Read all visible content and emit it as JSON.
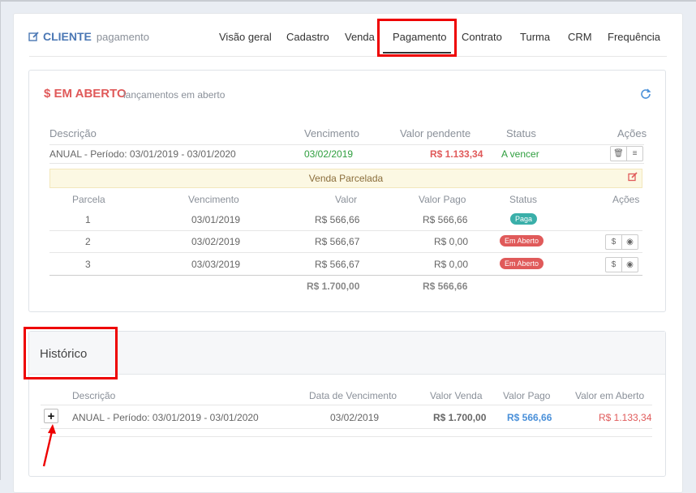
{
  "header": {
    "title": "CLIENTE",
    "subtitle": "pagamento",
    "tabs": [
      "Visão geral",
      "Cadastro",
      "Venda",
      "Pagamento",
      "Contrato",
      "Turma",
      "CRM",
      "Frequência"
    ],
    "active_tab": "Pagamento"
  },
  "em_aberto": {
    "title": "$ EM ABERTO",
    "subtitle": "lançamentos em aberto",
    "columns": [
      "Descrição",
      "Vencimento",
      "Valor pendente",
      "Status",
      "Ações"
    ],
    "row": {
      "descricao": "ANUAL - Período: 03/01/2019 - 03/01/2020",
      "vencimento": "03/02/2019",
      "valor": "R$ 1.133,34",
      "status": "A vencer"
    },
    "venda_label": "Venda Parcelada",
    "parcelas_columns": [
      "Parcela",
      "Vencimento",
      "Valor",
      "Valor Pago",
      "Status",
      "Ações"
    ],
    "parcelas": [
      {
        "n": "1",
        "vencimento": "03/01/2019",
        "valor": "R$ 566,66",
        "pago": "R$ 566,66",
        "status": "Paga"
      },
      {
        "n": "2",
        "vencimento": "03/02/2019",
        "valor": "R$ 566,67",
        "pago": "R$ 0,00",
        "status": "Em Aberto"
      },
      {
        "n": "3",
        "vencimento": "03/03/2019",
        "valor": "R$ 566,67",
        "pago": "R$ 0,00",
        "status": "Em Aberto"
      }
    ],
    "total_valor": "R$ 1.700,00",
    "total_pago": "R$ 566,66"
  },
  "historico": {
    "title": "Histórico",
    "columns": [
      "Descrição",
      "Data de Vencimento",
      "Valor Venda",
      "Valor Pago",
      "Valor em Aberto"
    ],
    "row": {
      "descricao": "ANUAL - Período: 03/01/2019 - 03/01/2020",
      "vencimento": "03/02/2019",
      "valor_venda": "R$ 1.700,00",
      "valor_pago": "R$ 566,66",
      "valor_aberto": "R$ 1.133,34"
    }
  },
  "colors": {
    "accent_blue": "#4a77b4",
    "red": "#e05a5a",
    "green": "#2e9e3e",
    "teal": "#3aafa9",
    "highlight_red": "#ee0000"
  },
  "icons": [
    "edit-icon",
    "refresh-icon",
    "trash-icon",
    "sliders-icon",
    "dollar-icon",
    "cancel-icon",
    "plus-icon",
    "arrow-icon"
  ]
}
